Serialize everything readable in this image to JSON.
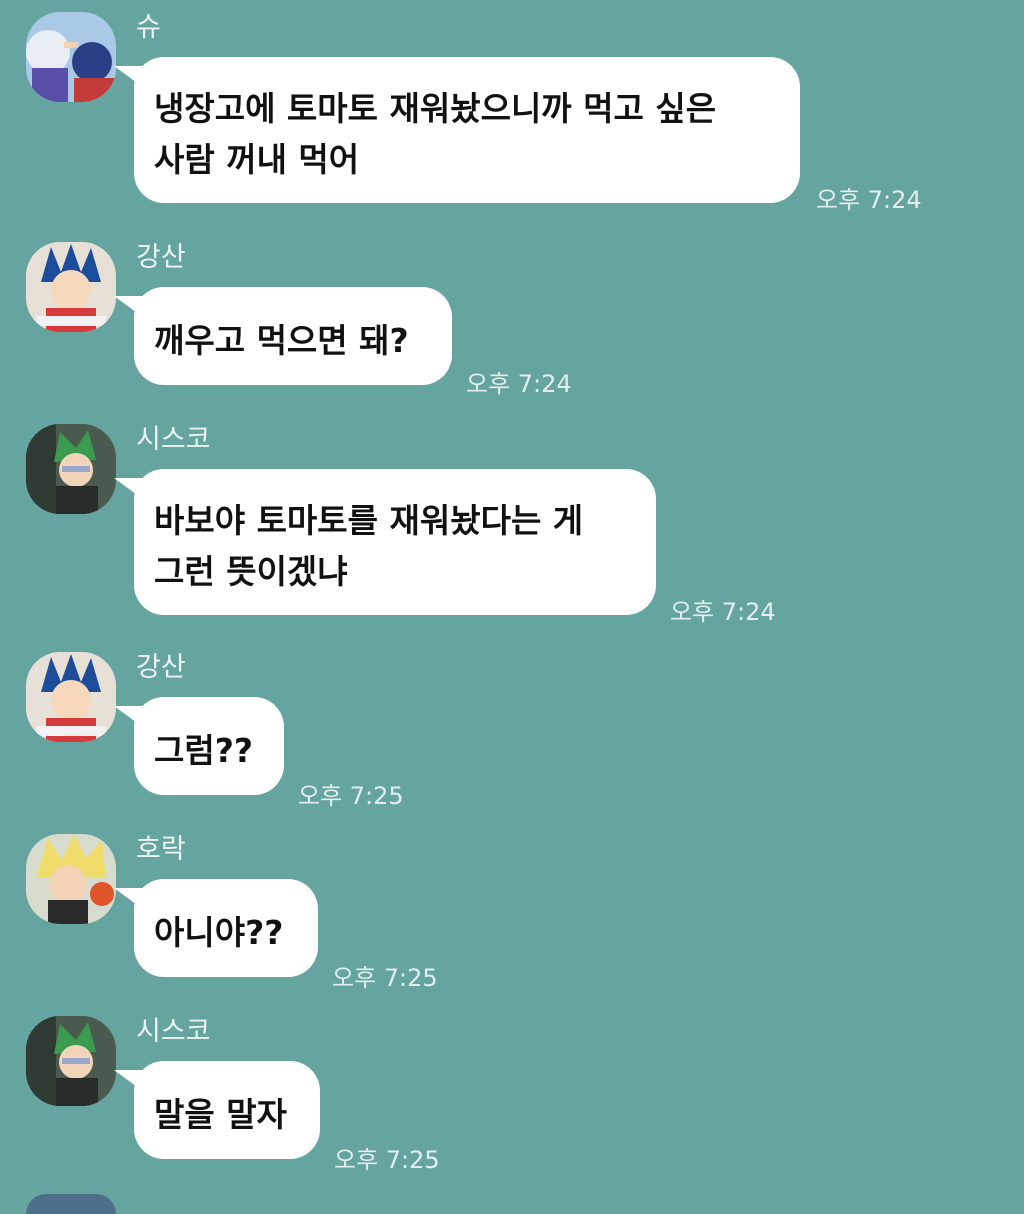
{
  "messages": [
    {
      "sender": "슈",
      "text": "냉장고에 토마토 재워놨으니까 먹고 싶은\n사람 꺼내 먹어",
      "time": "오후 7:24",
      "avatar": "shu-avatar"
    },
    {
      "sender": "강산",
      "text": "깨우고 먹으면 돼?",
      "time": "오후 7:24",
      "avatar": "gangsan-avatar"
    },
    {
      "sender": "시스코",
      "text": "바보야 토마토를 재워놨다는 게\n그런 뜻이겠냐",
      "time": "오후 7:24",
      "avatar": "cisco-avatar"
    },
    {
      "sender": "강산",
      "text": "그럼??",
      "time": "오후 7:25",
      "avatar": "gangsan-avatar"
    },
    {
      "sender": "호락",
      "text": "아니야??",
      "time": "오후 7:25",
      "avatar": "horak-avatar"
    },
    {
      "sender": "시스코",
      "text": "말을 말자",
      "time": "오후 7:25",
      "avatar": "cisco-avatar"
    }
  ],
  "colors": {
    "background": "#66a4a0",
    "bubble": "#ffffff",
    "text": "#111111",
    "meta_text": "#e3efee"
  }
}
